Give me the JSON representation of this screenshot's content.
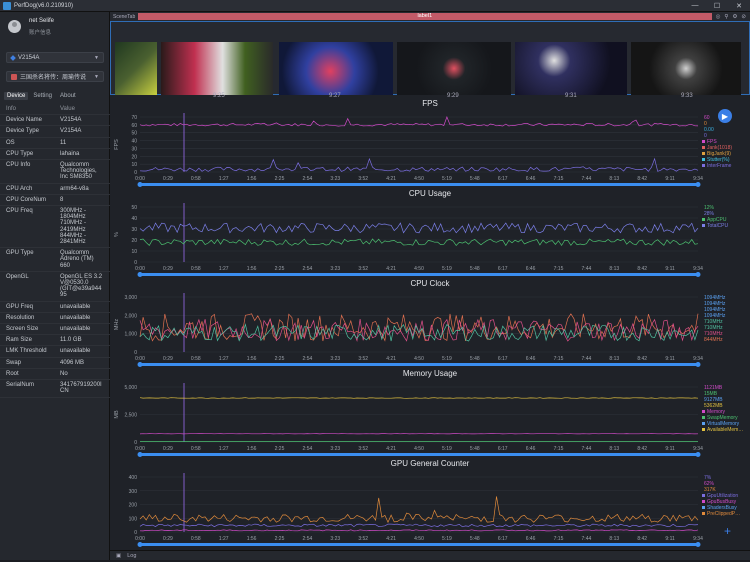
{
  "window": {
    "title": "PerfDog(v6.0.210910)"
  },
  "profile": {
    "name": "net Selife",
    "subtitle": "账户信息"
  },
  "device": {
    "name": "V2154A"
  },
  "app": {
    "name": "三国杀名将传：周瑜传说"
  },
  "tabs": [
    "Device",
    "Setting",
    "About"
  ],
  "info": {
    "header": [
      "Info",
      "Value"
    ],
    "rows": [
      [
        "Device Name",
        "V2154A"
      ],
      [
        "Device Type",
        "V2154A"
      ],
      [
        "OS",
        "11"
      ],
      [
        "CPU Type",
        "lahaina"
      ],
      [
        "CPU Info",
        "Qualcomm Technologies, Inc SM8350"
      ],
      [
        "CPU Arch",
        "arm64-v8a"
      ],
      [
        "CPU CoreNum",
        "8"
      ],
      [
        "CPU Freq",
        "300MHz - 1804MHz 710MHz - 2419MHz 844MHz - 2841MHz"
      ],
      [
        "GPU Type",
        "Qualcomm Adreno (TM) 660"
      ],
      [
        "OpenGL",
        "OpenGL ES 3.2 V@0530.0 (GIT@e39a94495"
      ],
      [
        "GPU Freq",
        "unavailable"
      ],
      [
        "Resolution",
        "unavailable"
      ],
      [
        "Screen Size",
        "unavailable"
      ],
      [
        "Ram Size",
        "11.0 GB"
      ],
      [
        "LMK Threshold",
        "unavailable"
      ],
      [
        "Swap",
        "4096 MB"
      ],
      [
        "Root",
        "No"
      ],
      [
        "SerialNum",
        "341767919200ICN"
      ]
    ]
  },
  "scene": {
    "tab_label": "SceneTab",
    "label": "label1"
  },
  "thumb_times": [
    "9:25",
    "9:27",
    "9:29",
    "9:31",
    "9:33"
  ],
  "time_ticks": [
    "0:00",
    "0:29",
    "0:58",
    "1:27",
    "1:56",
    "2:25",
    "2:54",
    "3:23",
    "3:52",
    "4:21",
    "4:50",
    "5:19",
    "5:48",
    "6:17",
    "6:46",
    "7:15",
    "7:44",
    "8:13",
    "8:42",
    "9:11",
    "9:34"
  ],
  "charts": [
    {
      "title": "FPS",
      "ylabel": "FPS",
      "yticks": [
        "0",
        "10",
        "20",
        "30",
        "40",
        "50",
        "60",
        "70"
      ],
      "ymax": 70,
      "legend": [
        {
          "text": "60",
          "color": "#d04bc8"
        },
        {
          "text": "0",
          "color": "#e08a3b"
        },
        {
          "text": "0.00",
          "color": "#3bb0e0"
        },
        {
          "text": "0",
          "color": "#7b6ee0"
        },
        {
          "text": "FPS",
          "color": "#d04bc8"
        },
        {
          "text": "Jank(1018)",
          "color": "#e06060"
        },
        {
          "text": "BigJank(9)",
          "color": "#e0a040"
        },
        {
          "text": "Stutter(%)",
          "color": "#40c0e0"
        },
        {
          "text": "InterFrame",
          "color": "#7b6ee0"
        }
      ]
    },
    {
      "title": "CPU Usage",
      "ylabel": "%",
      "yticks": [
        "0",
        "10",
        "20",
        "30",
        "40",
        "50"
      ],
      "ymax": 50,
      "legend": [
        {
          "text": "12%",
          "color": "#4cc070"
        },
        {
          "text": "28%",
          "color": "#7b7fe8"
        },
        {
          "text": "AppCPU",
          "color": "#4cc070"
        },
        {
          "text": "TotalCPU",
          "color": "#7b7fe8"
        }
      ]
    },
    {
      "title": "CPU Clock",
      "ylabel": "MHz",
      "yticks": [
        "0",
        "1,000",
        "2,000",
        "3,000"
      ],
      "ymax": 3000,
      "legend": [
        {
          "text": "1094MHz",
          "color": "#5aa0f0"
        },
        {
          "text": "1094MHz",
          "color": "#5aa0f0"
        },
        {
          "text": "1094MHz",
          "color": "#5aa0f0"
        },
        {
          "text": "1094MHz",
          "color": "#5aa0f0"
        },
        {
          "text": "710MHz",
          "color": "#50c0a0"
        },
        {
          "text": "710MHz",
          "color": "#50c0a0"
        },
        {
          "text": "710MHz",
          "color": "#e0508a"
        },
        {
          "text": "844MHz",
          "color": "#e07050"
        }
      ]
    },
    {
      "title": "Memory Usage",
      "ylabel": "MB",
      "yticks": [
        "0",
        "2,500",
        "5,000"
      ],
      "ymax": 7500,
      "legend": [
        {
          "text": "1121MB",
          "color": "#d04bc8"
        },
        {
          "text": "15MB",
          "color": "#4cc070"
        },
        {
          "text": "9127MB",
          "color": "#5aa0f0"
        },
        {
          "text": "5362MB",
          "color": "#e0c040"
        },
        {
          "text": "Memory",
          "color": "#d04bc8"
        },
        {
          "text": "SwapMemory",
          "color": "#4cc070"
        },
        {
          "text": "VirtualMemory",
          "color": "#5aa0f0"
        },
        {
          "text": "AvailableMem…",
          "color": "#e0c040"
        }
      ]
    },
    {
      "title": "GPU General Counter",
      "ylabel": "",
      "yticks": [
        "0",
        "100",
        "200",
        "300",
        "400"
      ],
      "ymax": 400,
      "legend": [
        {
          "text": "7%",
          "color": "#7b6ee0"
        },
        {
          "text": "62%",
          "color": "#d04bc8"
        },
        {
          "text": "317K",
          "color": "#e08a3b"
        },
        {
          "text": "GpuUtilization",
          "color": "#7b6ee0"
        },
        {
          "text": "GpuBusBusy",
          "color": "#d04bc8"
        },
        {
          "text": "ShadersBusy",
          "color": "#5aa0f0"
        },
        {
          "text": "PreClippedP…",
          "color": "#e08a3b"
        }
      ]
    }
  ],
  "status": {
    "log": "Log"
  },
  "colors": {
    "accent": "#3b7fe6",
    "label": "#c25a67",
    "bg": "#1f2228"
  }
}
